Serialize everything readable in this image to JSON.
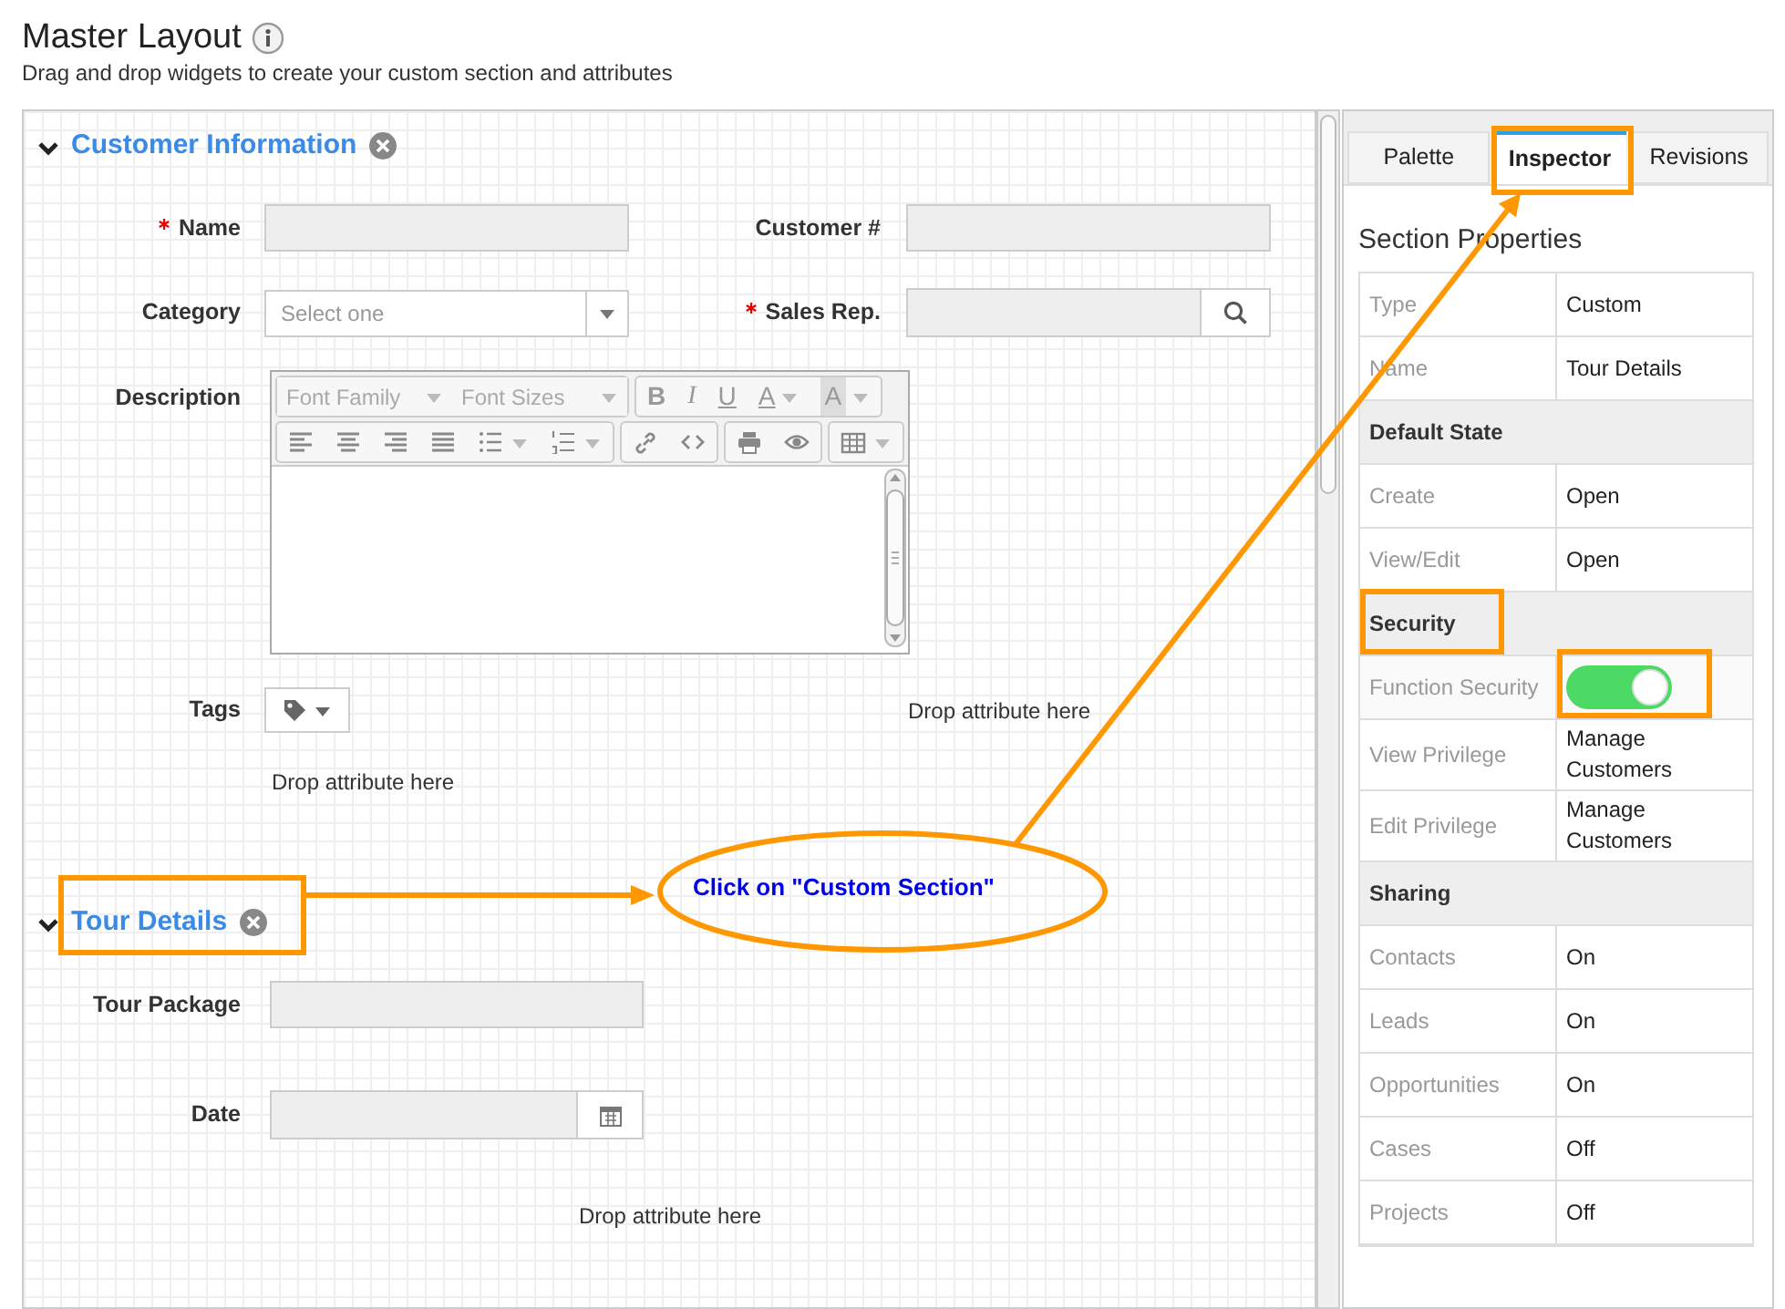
{
  "header": {
    "title": "Master Layout",
    "subtitle": "Drag and drop widgets to create your custom section and attributes"
  },
  "sections": [
    {
      "title": "Customer Information",
      "expanded": true,
      "rows": [
        [
          {
            "kind": "text",
            "label": "Name",
            "required": true
          },
          {
            "kind": "text",
            "label": "Customer #",
            "required": false
          }
        ],
        [
          {
            "kind": "select",
            "label": "Category",
            "required": false,
            "placeholder": "Select one"
          },
          {
            "kind": "lookup",
            "label": "Sales Rep.",
            "required": true
          }
        ],
        [
          {
            "kind": "editor",
            "label": "Description",
            "required": false,
            "dropdowns": [
              "Font Family",
              "Font Sizes"
            ],
            "letters": [
              "B",
              "I",
              "U",
              "A",
              "A"
            ]
          }
        ],
        [
          {
            "kind": "tags",
            "label": "Tags",
            "required": false
          },
          {
            "kind": "drop",
            "label": "Drop attribute here"
          }
        ],
        [
          {
            "kind": "drop",
            "label": "Drop attribute here"
          }
        ]
      ]
    },
    {
      "title": "Tour Details",
      "expanded": true,
      "rows": [
        [
          {
            "kind": "text",
            "label": "Tour Package",
            "required": false
          }
        ],
        [
          {
            "kind": "date",
            "label": "Date",
            "required": false
          }
        ],
        [
          {
            "kind": "drop",
            "label": "Drop attribute here"
          }
        ]
      ]
    }
  ],
  "inspector": {
    "tabs": [
      {
        "label": "Palette",
        "selected": false
      },
      {
        "label": "Inspector",
        "selected": true
      },
      {
        "label": "Revisions",
        "selected": false
      }
    ],
    "title": "Section Properties",
    "properties": [
      {
        "kind": "row",
        "label": "Type",
        "value": "Custom"
      },
      {
        "kind": "row",
        "label": "Name",
        "value": "Tour Details"
      },
      {
        "kind": "header",
        "label": "Default State"
      },
      {
        "kind": "row",
        "label": "Create",
        "value": "Open"
      },
      {
        "kind": "row",
        "label": "View/Edit",
        "value": "Open"
      },
      {
        "kind": "header",
        "label": "Security"
      },
      {
        "kind": "toggle",
        "label": "Function Security",
        "on": true
      },
      {
        "kind": "row",
        "label": "View Privilege",
        "value": "Manage Customers"
      },
      {
        "kind": "row",
        "label": "Edit Privilege",
        "value": "Manage Customers"
      },
      {
        "kind": "header",
        "label": "Sharing"
      },
      {
        "kind": "row",
        "label": "Contacts",
        "value": "On"
      },
      {
        "kind": "row",
        "label": "Leads",
        "value": "On"
      },
      {
        "kind": "row",
        "label": "Opportunities",
        "value": "On"
      },
      {
        "kind": "row",
        "label": "Cases",
        "value": "Off"
      },
      {
        "kind": "row",
        "label": "Projects",
        "value": "Off"
      }
    ]
  },
  "annotation": {
    "callout": "Click on \"Custom Section\""
  }
}
